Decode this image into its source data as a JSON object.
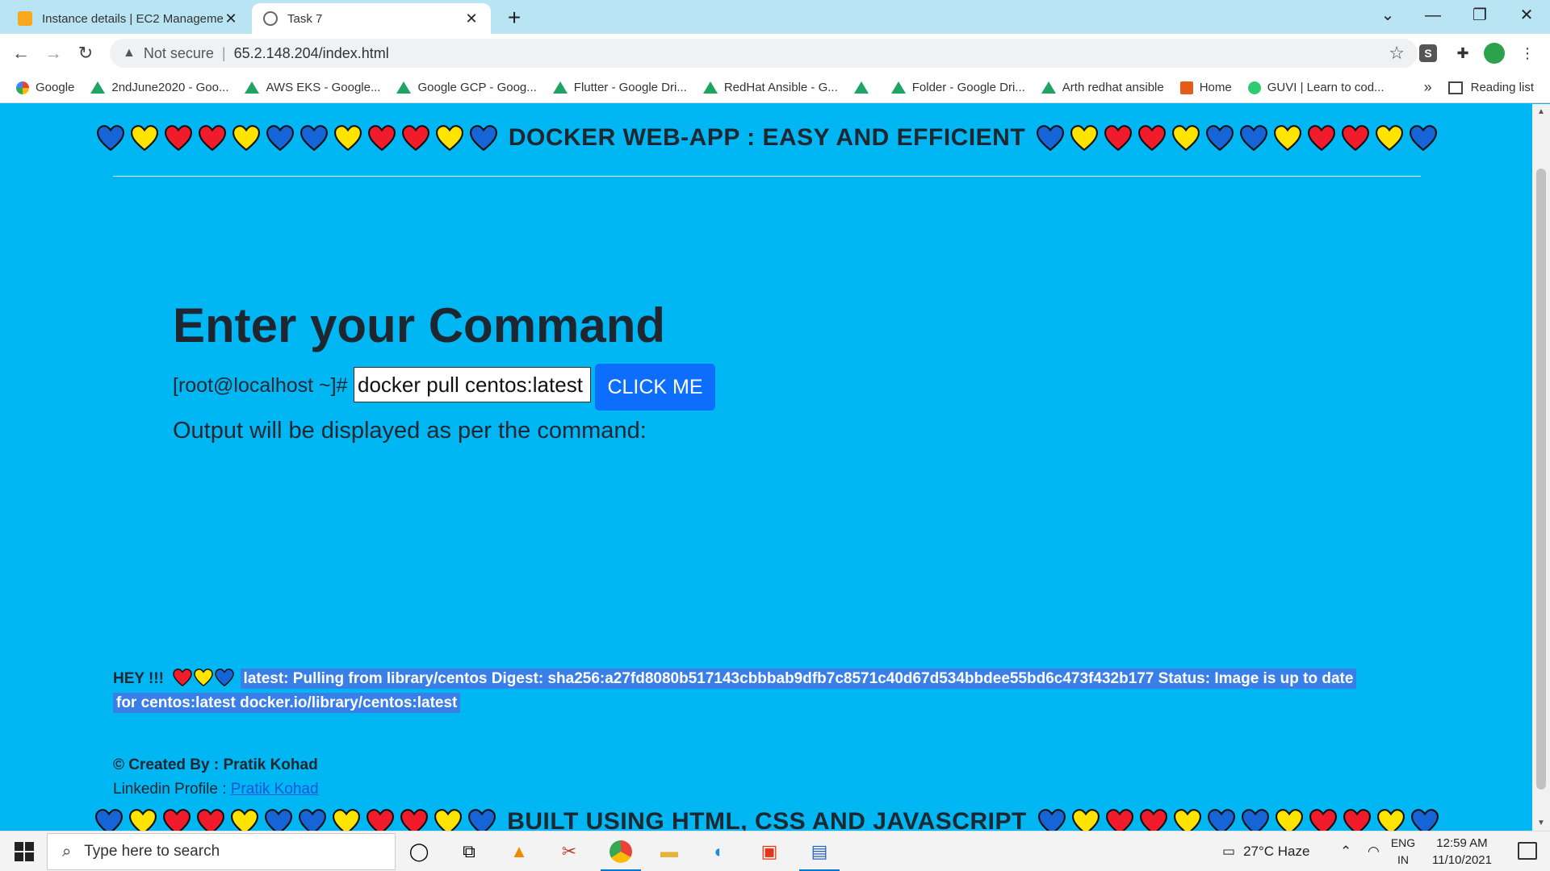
{
  "browser": {
    "tabs": [
      {
        "title": "Instance details | EC2 Manageme",
        "favicon": "aws-icon",
        "active": false
      },
      {
        "title": "Task 7",
        "favicon": "globe-icon",
        "active": true
      }
    ],
    "address": {
      "security_text": "Not secure",
      "url": "65.2.148.204/index.html"
    },
    "bookmarks": [
      {
        "label": "Google",
        "icon": "google-icon"
      },
      {
        "label": "2ndJune2020 - Goo...",
        "icon": "drive-icon"
      },
      {
        "label": "AWS EKS - Google...",
        "icon": "drive-icon"
      },
      {
        "label": "Google GCP - Goog...",
        "icon": "drive-icon"
      },
      {
        "label": "Flutter - Google Dri...",
        "icon": "drive-icon"
      },
      {
        "label": "RedHat Ansible - G...",
        "icon": "drive-icon"
      },
      {
        "label": "",
        "icon": "drive-icon"
      },
      {
        "label": "Folder - Google Dri...",
        "icon": "drive-icon"
      },
      {
        "label": "Arth redhat ansible",
        "icon": "drive-icon"
      },
      {
        "label": "Home",
        "icon": "alibaba-icon"
      },
      {
        "label": "GUVI | Learn to cod...",
        "icon": "guvi-icon"
      }
    ],
    "bookmarks_more": "»",
    "reading_list": "Reading list"
  },
  "page": {
    "header_title": "DOCKER WEB-APP : EASY AND EFFICIENT",
    "heart_pattern": [
      "blue",
      "yellow",
      "red",
      "red",
      "yellow",
      "blue",
      "blue",
      "yellow",
      "red",
      "red",
      "yellow",
      "blue"
    ],
    "command_title": "Enter your Command",
    "prompt": "[root@localhost ~]#",
    "command_value": "docker pull centos:latest",
    "button_label": "CLICK ME",
    "output_label": "Output will be displayed as per the command:",
    "result_prefix": "HEY !!!",
    "result_hearts": [
      "red",
      "yellow",
      "blue"
    ],
    "result_text_line1": "latest: Pulling from library/centos Digest: sha256:a27fd8080b517143cbbbab9dfb7c8571c40d67d534bbdee55bd6c473f432b177 Status: Image is up to date",
    "result_text_line2": "for centos:latest docker.io/library/centos:latest",
    "created_by": "© Created By : Pratik Kohad",
    "linkedin_label": "Linkedin Profile : ",
    "linkedin_link": "Pratik Kohad",
    "footer_title": "BUILT USING HTML, CSS AND JAVASCRIPT"
  },
  "colors": {
    "page_bg": "#00b6f3",
    "button": "#0d6efd",
    "heart_blue": "#1565d8",
    "heart_yellow": "#ffe400",
    "heart_red": "#f01c2b"
  },
  "taskbar": {
    "search_placeholder": "Type here to search",
    "weather": "27°C  Haze",
    "lang_top": "ENG",
    "lang_bottom": "IN",
    "time": "12:59 AM",
    "date": "11/10/2021"
  }
}
